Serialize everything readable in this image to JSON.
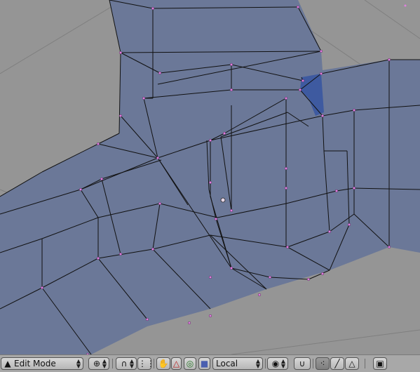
{
  "viewport": {
    "name": "3d-viewport",
    "mesh_color": "#6b7898",
    "selected_face_color": "#3e5aa0",
    "wire_color": "#111111",
    "vertex_color": "#e080e0",
    "grid_color": "#7f7f7f"
  },
  "header": {
    "mode_label": "Edit Mode",
    "pivot_icon": "pivot-icon",
    "snap_icon": "magnet-icon",
    "transform_orientation": "Local",
    "colors": {
      "bar": "#a8a8a8",
      "button": "#c8c8c8",
      "pressed": "#8c8c8c"
    }
  }
}
